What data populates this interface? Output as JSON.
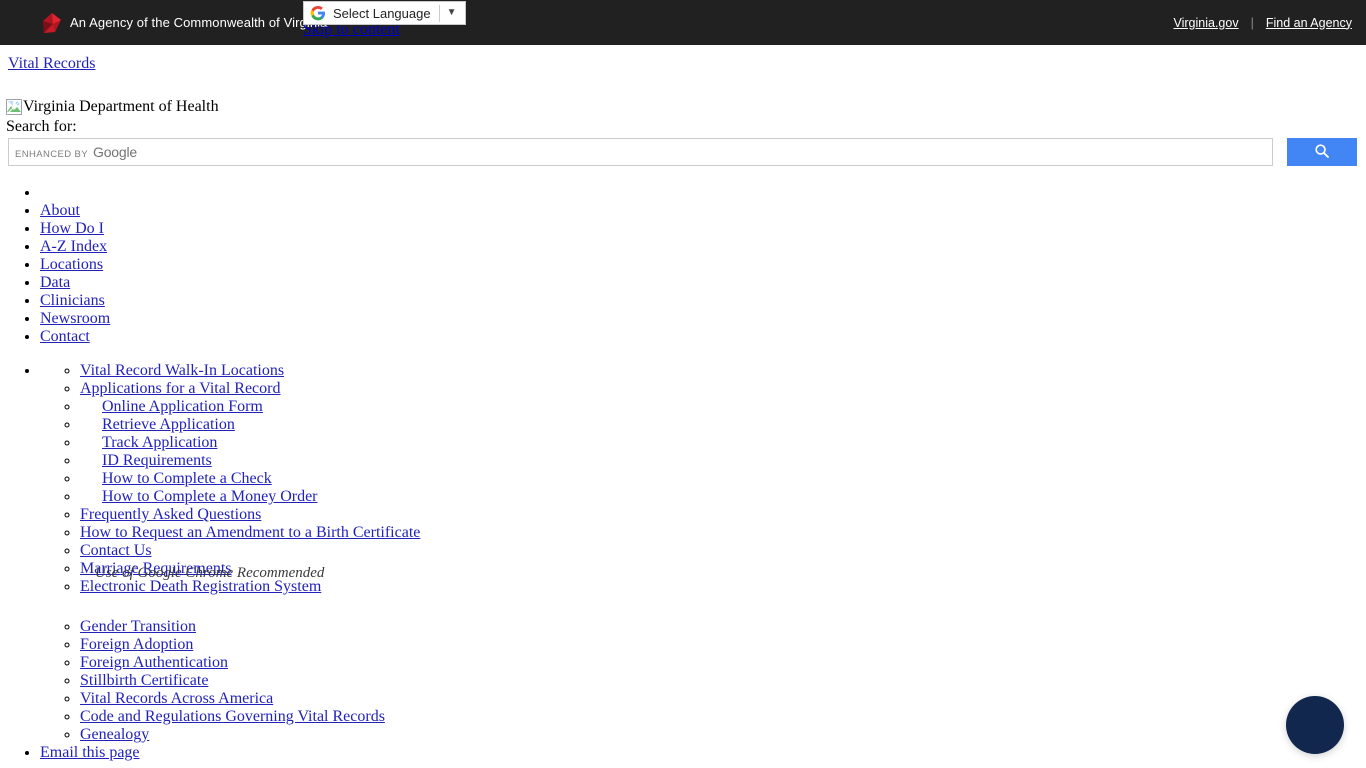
{
  "gov_bar": {
    "agency_text": "An Agency of the Commonwealth of Virginia",
    "logo_icon": "virginia-commonwealth-logo",
    "virginia_gov_link": "Virginia.gov",
    "separator": "|",
    "find_agency_link": "Find an Agency",
    "background_color": "#212121"
  },
  "translate_widget": {
    "icon": "google-g-icon",
    "label": "Select Language",
    "caret_icon": "chevron-down-icon",
    "caret_glyph": "▼"
  },
  "skip_link": {
    "label": "Skip to content"
  },
  "site": {
    "title_link": "Vital Records",
    "logo_alt_text": "Virginia Department of Health",
    "logo_icon": "broken-image-icon"
  },
  "search": {
    "label": "Search for:",
    "placeholder": "",
    "value": "",
    "branding_prefix": "ENHANCED BY",
    "branding_name": "Google",
    "button_icon": "search-icon",
    "button_color": "#4285f4"
  },
  "primary_nav": {
    "items": [
      {
        "label": ""
      },
      {
        "label": "About"
      },
      {
        "label": "How Do I"
      },
      {
        "label": "A-Z Index"
      },
      {
        "label": "Locations"
      },
      {
        "label": "Data"
      },
      {
        "label": "Clinicians"
      },
      {
        "label": "Newsroom"
      },
      {
        "label": "Contact"
      }
    ]
  },
  "secondary_nav": {
    "group_one": [
      {
        "label": "Vital Record Walk-In Locations",
        "indented": false
      },
      {
        "label": "Applications for a Vital Record",
        "indented": false
      },
      {
        "label": "Online Application Form",
        "indented": true
      },
      {
        "label": "Retrieve Application",
        "indented": true
      },
      {
        "label": "Track Application",
        "indented": true
      },
      {
        "label": "ID Requirements",
        "indented": true
      },
      {
        "label": "How to Complete a Check",
        "indented": true
      },
      {
        "label": "How to Complete a Money Order",
        "indented": true
      },
      {
        "label": "Frequently Asked Questions",
        "indented": false
      },
      {
        "label": "How to Request an Amendment to a Birth Certificate",
        "indented": false
      },
      {
        "label": "Contact Us",
        "indented": false
      },
      {
        "label": "Marriage Requirements",
        "indented": false
      },
      {
        "label": "Electronic Death Registration System",
        "indented": false
      }
    ],
    "group_two": [
      {
        "label": "Gender Transition"
      },
      {
        "label": "Foreign Adoption"
      },
      {
        "label": "Foreign Authentication"
      },
      {
        "label": "Stillbirth Certificate"
      },
      {
        "label": "Vital Records Across America"
      },
      {
        "label": "Code and Regulations Governing Vital Records"
      },
      {
        "label": "Genealogy"
      }
    ],
    "email_page_label": "Email this page"
  },
  "overlay_note": {
    "text": "Use of Google Chrome Recommended"
  },
  "chat_widget": {
    "icon": "chat-bubble-icon",
    "color": "#11274e"
  }
}
